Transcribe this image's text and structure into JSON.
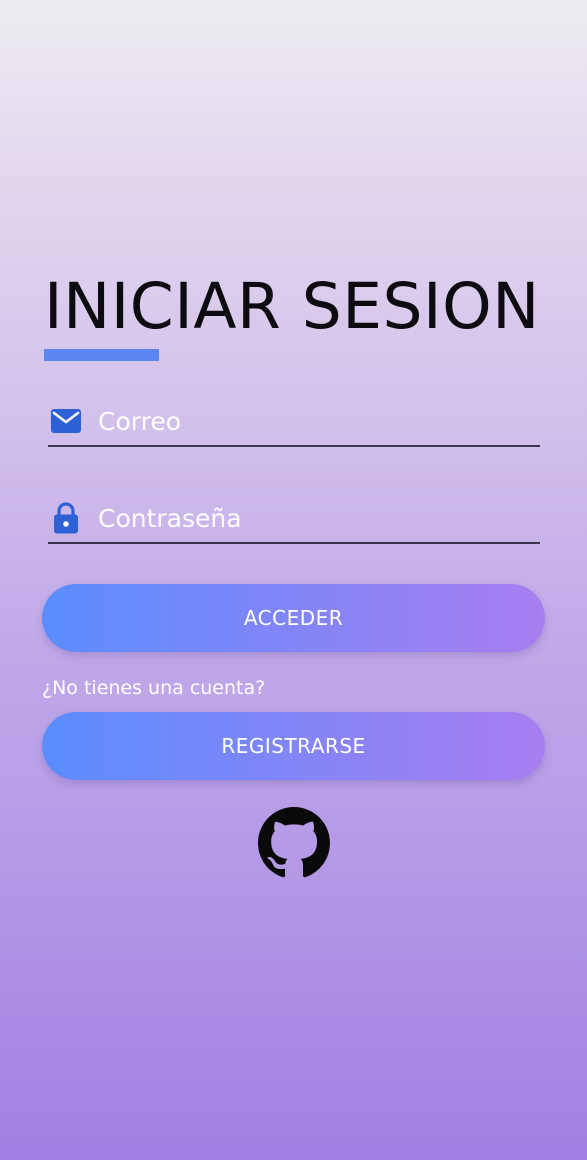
{
  "login": {
    "title": "INICIAR SESION",
    "email_placeholder": "Correo",
    "password_placeholder": "Contraseña",
    "submit_label": "ACCEDER",
    "no_account_text": "¿No tienes una cuenta?",
    "register_label": "REGISTRARSE"
  },
  "icons": {
    "email": "mail-icon",
    "password": "lock-icon",
    "social": "github-icon"
  },
  "colors": {
    "accent": "#5b86f2",
    "icon": "#2f61d6",
    "button_start": "#5a8cfd",
    "button_end": "#a87ef0",
    "background_top": "#eeedf1",
    "background_bottom": "#a37ee3"
  }
}
